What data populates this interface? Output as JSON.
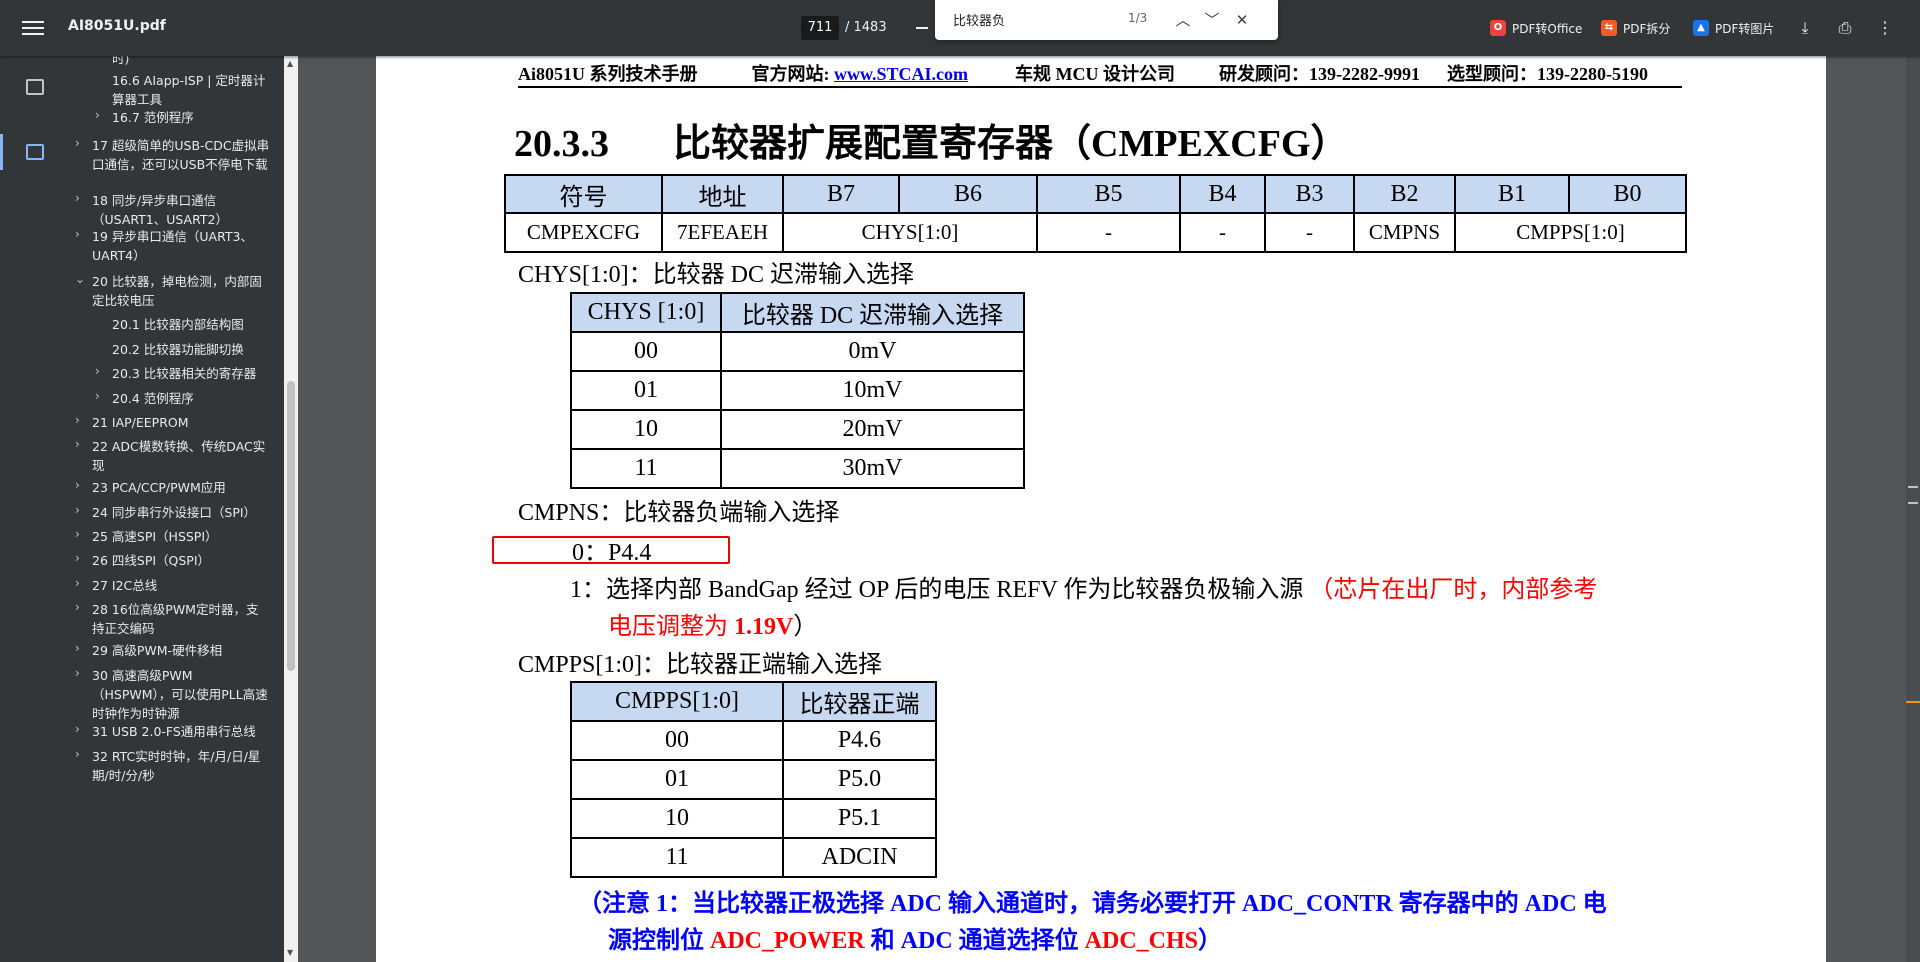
{
  "toolbar": {
    "title": "AI8051U.pdf",
    "page_current": "711",
    "page_total": "/ 1483",
    "find": {
      "query": "比较器负",
      "count": "1/3"
    },
    "actions": [
      {
        "label": "PDF转Office",
        "icon": "O",
        "color": "#e8453c"
      },
      {
        "label": "PDF拆分",
        "icon": "⇆",
        "color": "#f25c2a"
      },
      {
        "label": "PDF转图片",
        "icon": "▲",
        "color": "#1a73e8"
      }
    ]
  },
  "outline": [
    {
      "label": "时)",
      "level": 2,
      "chevron": ""
    },
    {
      "label": "16.6 AIapp-ISP | 定时器计算器工具",
      "level": 2,
      "chevron": ""
    },
    {
      "label": "16.7 范例程序",
      "level": 2,
      "chevron": "›"
    },
    {
      "label": "17 超级简单的USB-CDC虚拟串口通信，还可以USB不停电下载",
      "level": 1,
      "chevron": "›"
    },
    {
      "label": "18 同步/异步串口通信（USART1、USART2）",
      "level": 1,
      "chevron": "›"
    },
    {
      "label": "19 异步串口通信（UART3、UART4）",
      "level": 1,
      "chevron": "›"
    },
    {
      "label": "20 比较器，掉电检测，内部固定比较电压",
      "level": 1,
      "chevron": "⌄"
    },
    {
      "label": "20.1 比较器内部结构图",
      "level": 2,
      "chevron": ""
    },
    {
      "label": "20.2 比较器功能脚切换",
      "level": 2,
      "chevron": ""
    },
    {
      "label": "20.3 比较器相关的寄存器",
      "level": 2,
      "chevron": "›"
    },
    {
      "label": "20.4 范例程序",
      "level": 2,
      "chevron": "›"
    },
    {
      "label": "21 IAP/EEPROM",
      "level": 1,
      "chevron": "›"
    },
    {
      "label": "22 ADC模数转换、传统DAC实现",
      "level": 1,
      "chevron": "›"
    },
    {
      "label": "23 PCA/CCP/PWM应用",
      "level": 1,
      "chevron": "›"
    },
    {
      "label": "24 同步串行外设接口（SPI）",
      "level": 1,
      "chevron": "›"
    },
    {
      "label": "25 高速SPI（HSSPI）",
      "level": 1,
      "chevron": "›"
    },
    {
      "label": "26 四线SPI（QSPI）",
      "level": 1,
      "chevron": "›"
    },
    {
      "label": "27 I2C总线",
      "level": 1,
      "chevron": "›"
    },
    {
      "label": "28 16位高级PWM定时器，支持正交编码",
      "level": 1,
      "chevron": "›"
    },
    {
      "label": "29 高级PWM-硬件移相",
      "level": 1,
      "chevron": "›"
    },
    {
      "label": "30 高速高级PWM（HSPWM），可以使用PLL高速时钟作为时钟源",
      "level": 1,
      "chevron": "›"
    },
    {
      "label": "31 USB 2.0-FS通用串行总线",
      "level": 1,
      "chevron": "›"
    },
    {
      "label": "32 RTC实时时钟，年/月/日/星期/时/分/秒",
      "level": 1,
      "chevron": "›"
    }
  ],
  "doc": {
    "header": {
      "manual": "Ai8051U 系列技术手册",
      "site_label": "官方网站:",
      "site_link": "www.STCAI.com",
      "company": "车规 MCU 设计公司",
      "dev_consult": "研发顾问：139-2282-9991",
      "sel_consult": "选型顾问：139-2280-5190"
    },
    "section_num": "20.3.3",
    "section_title": "比较器扩展配置寄存器（CMPEXCFG）",
    "reg_table": {
      "head": [
        "符号",
        "地址",
        "B7",
        "B6",
        "B5",
        "B4",
        "B3",
        "B2",
        "B1",
        "B0"
      ],
      "row": [
        "CMPEXCFG",
        "7EFEAEH",
        "CHYS[1:0]",
        "-",
        "-",
        "-",
        "CMPNS",
        "CMPPS[1:0]"
      ]
    },
    "chys_title": "CHYS[1:0]：比较器 DC 迟滞输入选择",
    "chys_table": {
      "head": [
        "CHYS [1:0]",
        "比较器 DC 迟滞输入选择"
      ],
      "rows": [
        [
          "00",
          "0mV"
        ],
        [
          "01",
          "10mV"
        ],
        [
          "10",
          "20mV"
        ],
        [
          "11",
          "30mV"
        ]
      ]
    },
    "cmpns_title": "CMPNS：比较器负端输入选择",
    "cmpns_0": "0：P4.4",
    "cmpns_1_a": "1：选择内部 BandGap 经过 OP 后的电压 REFV 作为比较器负极输入源 ",
    "cmpns_1_red_a": "（芯片在出厂时，内部参考",
    "cmpns_1_red_b": "电压调整为 ",
    "cmpns_1_red_bold": "1.19V",
    "cmpns_1_end": "）",
    "cmpps_title": "CMPPS[1:0]：比较器正端输入选择",
    "cmpps_table": {
      "head": [
        "CMPPS[1:0]",
        "比较器正端"
      ],
      "rows": [
        [
          "00",
          "P4.6"
        ],
        [
          "01",
          "P5.0"
        ],
        [
          "10",
          "P5.1"
        ],
        [
          "11",
          "ADCIN"
        ]
      ]
    },
    "note_a": "（注意 1：当比较器正极选择 ADC 输入通道时，请务必要打开 ADC_CONTR 寄存器中的 ADC 电",
    "note_b_1": "源控制位 ",
    "note_b_red1": "ADC_POWER",
    "note_b_2": " 和 ADC 通道选择位 ",
    "note_b_red2": "ADC_CHS",
    "note_b_3": "）"
  }
}
